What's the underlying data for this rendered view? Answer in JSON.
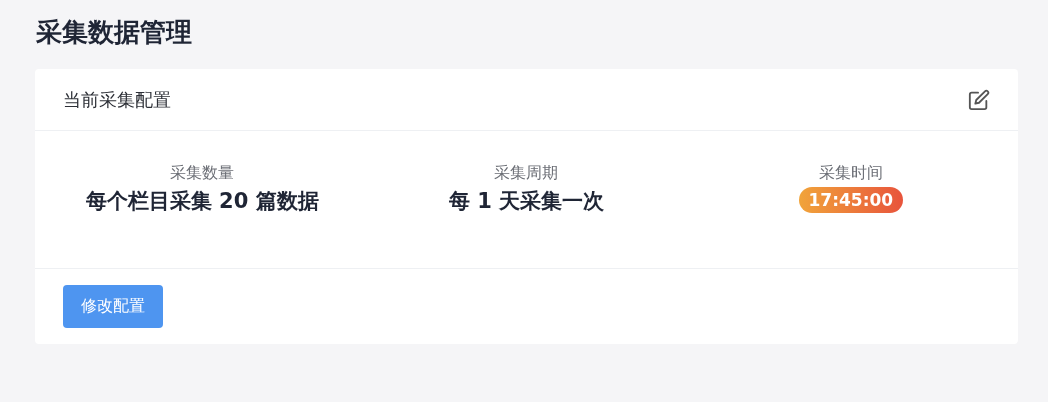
{
  "page": {
    "title": "采集数据管理"
  },
  "card": {
    "title": "当前采集配置",
    "stats": [
      {
        "kind": "text",
        "label": "采集数量",
        "value": "每个栏目采集 20 篇数据"
      },
      {
        "kind": "text",
        "label": "采集周期",
        "value": "每 1 天采集一次"
      },
      {
        "kind": "badge",
        "label": "采集时间",
        "value": "17:45:00"
      }
    ],
    "button": "修改配置"
  }
}
